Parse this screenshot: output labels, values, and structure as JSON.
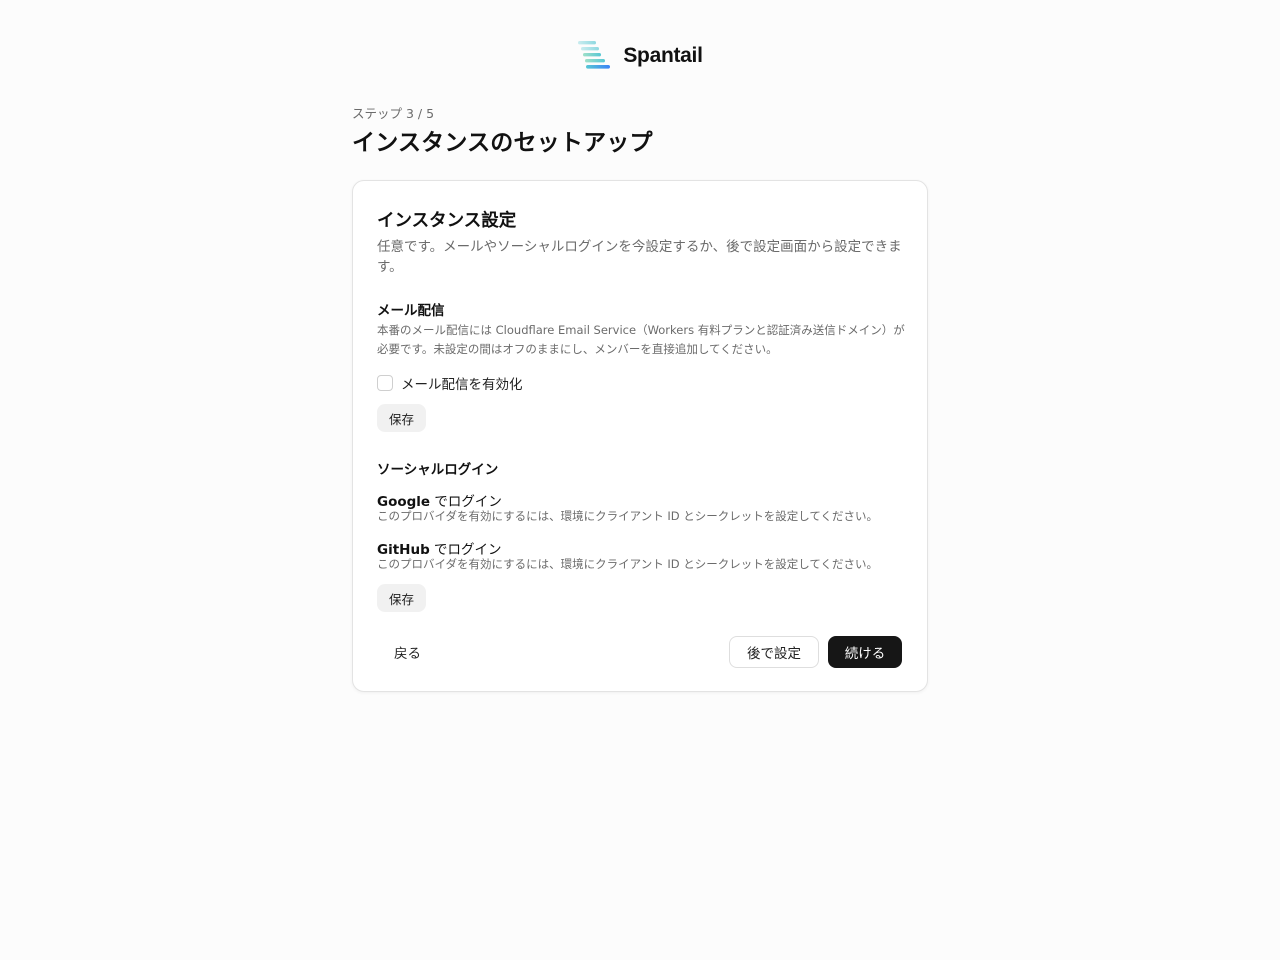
{
  "brand": {
    "name": "Spantail",
    "logo_icon": "spantail-logo-icon"
  },
  "header": {
    "step": "ステップ 3 / 5",
    "title": "インスタンスのセットアップ"
  },
  "card": {
    "title": "インスタンス設定",
    "description": "任意です。メールやソーシャルログインを今設定するか、後で設定画面から設定できます。",
    "email": {
      "title": "メール配信",
      "description": "本番のメール配信には Cloudflare Email Service（Workers 有料プランと認証済み送信ドメイン）が必要です。未設定の間はオフのままにし、メンバーを直接追加してください。",
      "checkbox_label": "メール配信を有効化",
      "checked": false,
      "save_label": "保存"
    },
    "social": {
      "title": "ソーシャルログイン",
      "providers": [
        {
          "brand": "Google",
          "suffix": " でログイン",
          "note": "このプロバイダを有効にするには、環境にクライアント ID とシークレットを設定してください。"
        },
        {
          "brand": "GitHub",
          "suffix": " でログイン",
          "note": "このプロバイダを有効にするには、環境にクライアント ID とシークレットを設定してください。"
        }
      ],
      "save_label": "保存"
    },
    "footer": {
      "back_label": "戻る",
      "later_label": "後で設定",
      "continue_label": "続ける"
    }
  },
  "colors": {
    "background": "#fcfcfc",
    "primary_button": "#161616",
    "muted_text": "#6b6b6b",
    "logo_gradient": [
      "#a6dde6",
      "#57c7d4",
      "#3b82f6"
    ]
  }
}
